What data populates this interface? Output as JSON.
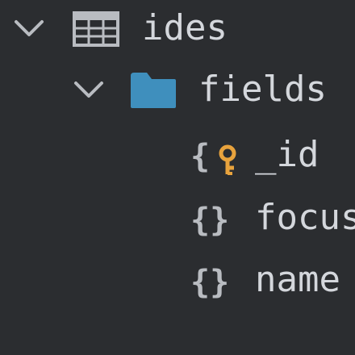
{
  "tree": {
    "items": [
      {
        "label": "ides",
        "icon": "table-icon",
        "expanded": true,
        "level": 0
      },
      {
        "label": "fields",
        "icon": "folder-icon",
        "expanded": true,
        "level": 1
      },
      {
        "label": "_id",
        "icon": "field-key-icon",
        "level": 2
      },
      {
        "label": "focus",
        "icon": "field-icon",
        "level": 2
      },
      {
        "label": "name",
        "icon": "field-icon",
        "level": 2
      }
    ]
  },
  "colors": {
    "background": "#2b2d30",
    "text": "#d4d7dc",
    "icon_gray": "#b9bcc1",
    "folder_blue": "#3f8fbd",
    "key_orange": "#e8a33d"
  }
}
